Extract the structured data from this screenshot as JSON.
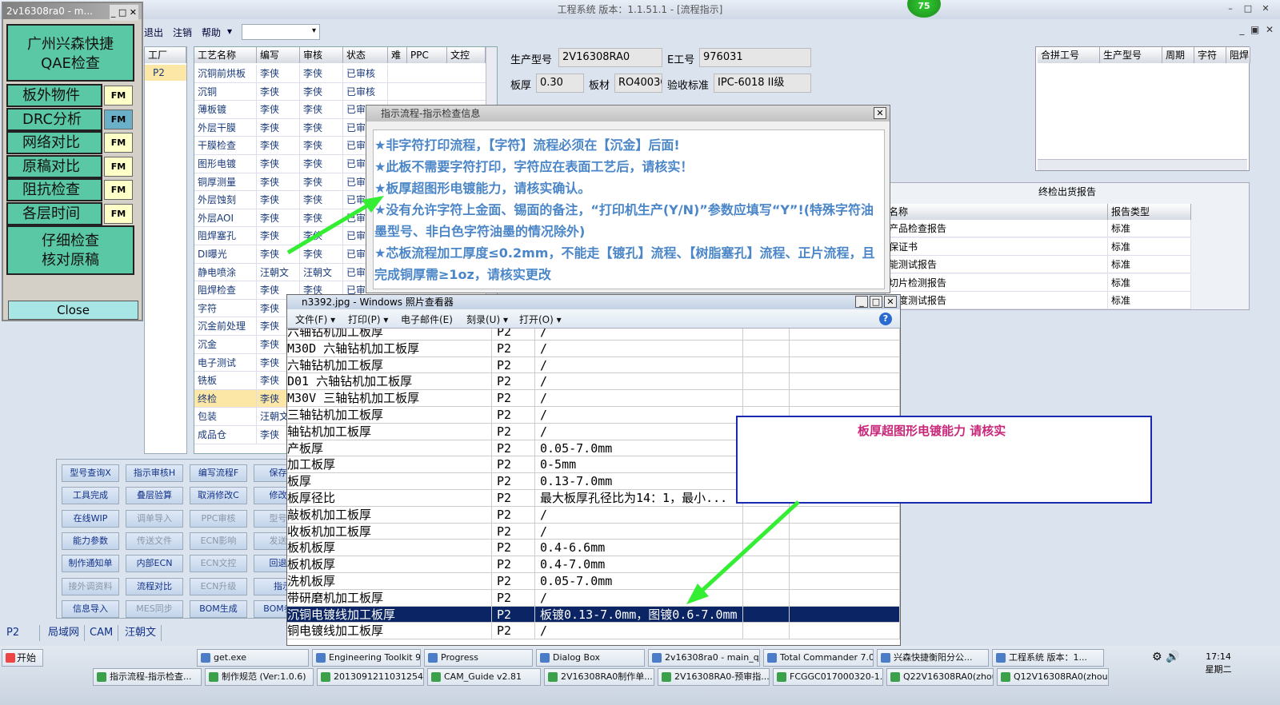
{
  "main_window": {
    "title": "工程系统   版本：1.1.51.1 - [流程指示]",
    "badge": "75"
  },
  "menu": {
    "exit": "退出",
    "logout": "注销",
    "help": "帮助",
    "help_arrow": "▾"
  },
  "left_grid": {
    "header": "工厂",
    "value": "P2"
  },
  "process_grid": {
    "headers": [
      "工艺名称",
      "编写",
      "审核",
      "状态",
      "难",
      "PPC",
      "文控"
    ],
    "rows": [
      [
        "沉铜前烘板",
        "李侠",
        "李侠",
        "已审核"
      ],
      [
        "沉铜",
        "李侠",
        "李侠",
        "已审核"
      ],
      [
        "薄板镀",
        "李侠",
        "李侠",
        "已审"
      ],
      [
        "外层干膜",
        "李侠",
        "李侠",
        "已审"
      ],
      [
        "干膜检查",
        "李侠",
        "李侠",
        "已审"
      ],
      [
        "图形电镀",
        "李侠",
        "李侠",
        "已审"
      ],
      [
        "铜厚测量",
        "李侠",
        "李侠",
        "已审"
      ],
      [
        "外层蚀刻",
        "李侠",
        "李侠",
        "已审"
      ],
      [
        "外层AOI",
        "李侠",
        "李侠",
        "已审"
      ],
      [
        "阻焊塞孔",
        "李侠",
        "李侠",
        "已审"
      ],
      [
        "DI曝光",
        "李侠",
        "李侠",
        "已审"
      ],
      [
        "静电喷涂",
        "汪朝文",
        "汪朝文",
        "已审"
      ],
      [
        "阻焊检查",
        "李侠",
        "李侠",
        "已审"
      ],
      [
        "字符",
        "李侠",
        "",
        ""
      ],
      [
        "沉金前处理",
        "李侠",
        "",
        ""
      ],
      [
        "沉金",
        "李侠",
        "",
        ""
      ],
      [
        "电子测试",
        "李侠",
        "",
        ""
      ],
      [
        "铣板",
        "李侠",
        "",
        ""
      ],
      [
        "终检",
        "李侠",
        "",
        ""
      ],
      [
        "包装",
        "汪朝文",
        "",
        ""
      ],
      [
        "成品仓",
        "李侠",
        "",
        ""
      ]
    ],
    "selected_index": 18
  },
  "info": {
    "model_label": "生产型号",
    "model": "2V16308RA0",
    "eno_label": "E工号",
    "eno": "976031",
    "thick_label": "板厚",
    "thick": "0.30",
    "mat_label": "板材",
    "mat": "RO4003C",
    "std_label": "验收标准",
    "std": "IPC-6018 II级"
  },
  "merge_grid": {
    "headers": [
      "合拼工号",
      "生产型号",
      "周期",
      "字符",
      "阻焊"
    ]
  },
  "report": {
    "title": "终检出货报告",
    "headers": [
      "名称",
      "报告类型"
    ],
    "rows": [
      [
        "产品检查报告",
        "标准"
      ],
      [
        "保证书",
        "标准"
      ],
      [
        "能测试报告",
        "标准"
      ],
      [
        "切片检测报告",
        "标准"
      ],
      [
        "厚度测试报告",
        "标准"
      ]
    ]
  },
  "buttons": [
    [
      "型号查询X",
      "指示审核H",
      "编写流程F",
      "保存信"
    ],
    [
      "工具完成",
      "叠层验算",
      "取消修改C",
      "修改模"
    ],
    [
      "在线WIP",
      "调单导入",
      "PPC审核",
      "型号上"
    ],
    [
      "能力参数",
      "传送文件",
      "ECN影响",
      "发送指"
    ],
    [
      "制作通知单",
      "内部ECN",
      "ECN文控",
      "回退审"
    ],
    [
      "接外调资料",
      "流程对比",
      "ECN升级",
      "指示"
    ],
    [
      "信息导入",
      "MES同步",
      "BOM生成",
      "BOM参数"
    ]
  ],
  "status": {
    "factory": "P2",
    "net": "局域网",
    "cam": "CAM",
    "user": "汪朝文"
  },
  "qae": {
    "title": "2v16308ra0 - m...",
    "head": "广州兴森快捷\nQAE检查",
    "items": [
      "板外物件",
      "DRC分析",
      "网络对比",
      "原稿对比",
      "阻抗检查",
      "各层时间"
    ],
    "fm": "FM",
    "foot": "仔细检查\n核对原稿",
    "close": "Close"
  },
  "indicator": {
    "title": "指示流程-指示检查信息",
    "lines": [
      "★非字符打印流程，【字符】流程必须在【沉金】后面!",
      "★此板不需要字符打印，字符应在表面工艺后，请核实！",
      "★板厚超图形电镀能力，请核实确认。",
      "★没有允许字符上金面、锡面的备注，“打印机生产(Y/N)”参数应填写“Y”!(特殊字符油墨型号、非白色字符油墨的情况除外)",
      "★芯板流程加工厚度≤0.2mm，不能走【镀孔】流程、【树脂塞孔】流程、正片流程，且完成铜厚需≥1oz，请核实更改"
    ]
  },
  "viewer": {
    "title": "n3392.jpg - Windows 照片查看器",
    "menu": [
      "文件(F) ▾",
      "打印(P) ▾",
      "电子邮件(E)",
      "刻录(U) ▾",
      "打开(O) ▾"
    ],
    "rows": [
      [
        "六轴钻机加工板厚",
        "P2",
        "/"
      ],
      [
        "M30D 六轴钻机加工板厚",
        "P2",
        "/"
      ],
      [
        "六轴钻机加工板厚",
        "P2",
        "/"
      ],
      [
        "D01 六轴钻机加工板厚",
        "P2",
        "/"
      ],
      [
        "M30V 三轴钻机加工板厚",
        "P2",
        "/"
      ],
      [
        "三轴钻机加工板厚",
        "P2",
        "/"
      ],
      [
        "轴钻机加工板厚",
        "P2",
        "/"
      ],
      [
        "产板厚",
        "P2",
        "0.05-7.0mm"
      ],
      [
        "加工板厚",
        "P2",
        "0-5mm"
      ],
      [
        "板厚",
        "P2",
        "0.13-7.0mm"
      ],
      [
        "板厚径比",
        "P2",
        "最大板厚孔径比为14：1，最小..."
      ],
      [
        "敲板机加工板厚",
        "P2",
        "/"
      ],
      [
        "收板机加工板厚",
        "P2",
        "/"
      ],
      [
        "板机板厚",
        "P2",
        "0.4-6.6mm"
      ],
      [
        "板机板厚",
        "P2",
        "0.4-7.0mm"
      ],
      [
        "洗机板厚",
        "P2",
        "0.05-7.0mm"
      ],
      [
        "带研磨机加工板厚",
        "P2",
        "/"
      ],
      [
        "沉铜电镀线加工板厚",
        "P2",
        "板镀0.13-7.0mm，图镀0.6-7.0mm"
      ],
      [
        "铜电镀线加工板厚",
        "P2",
        "/"
      ]
    ],
    "highlight": 17
  },
  "note": {
    "text": "板厚超图形电镀能力    请核实"
  },
  "taskbar": {
    "start": "开始",
    "row1": [
      "get.exe",
      "Engineering Toolkit 9....",
      "Progress",
      "Dialog Box",
      "2v16308ra0 - main_qa",
      "Total Commander 7.0...",
      "兴森快捷衡阳分公...",
      "工程系统  版本：1..."
    ],
    "row2": [
      "指示流程-指示检查...",
      "制作规范 (Ver:1.0.6)",
      "2013091211031254....",
      "CAM_Guide v2.81",
      "2V16308RA0制作单...",
      "2V16308RA0-预审指...",
      "FCGGC017000320-1...",
      "Q22V16308RA0(zhou...",
      "Q12V16308RA0(zhou..."
    ],
    "time": "17:14",
    "weekday": "星期二"
  },
  "colors": {
    "green_arrow": "#33ee33",
    "note_border": "#1a2ab0",
    "note_text": "#c8287a",
    "indicator_text": "#4a86c8"
  }
}
